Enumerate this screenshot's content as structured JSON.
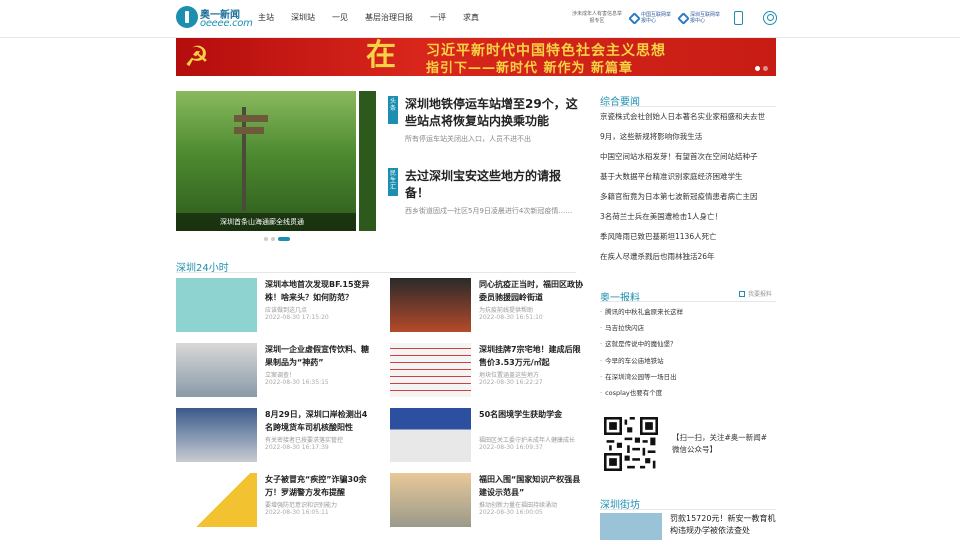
{
  "header": {
    "logo_cn": "奥一新闻",
    "logo_en": "oeeee.com",
    "nav": [
      "主站",
      "深圳站",
      "一见",
      "基层治理日报",
      "一评",
      "求真"
    ],
    "minor_report_note": "涉未成年人有害信息举报专区",
    "report_center_1": "中国互联网举报中心",
    "report_center_2": "深圳互联网举报中心"
  },
  "banner": {
    "big_char": "在",
    "line1": "习近平新时代中国特色社会主义思想",
    "line2": "指引下——新时代 新作为 新篇章"
  },
  "slider": {
    "caption": "深圳首条山海通廊全线贯通"
  },
  "headlines": [
    {
      "tag": "头条",
      "title": "深圳地铁停运车站增至29个，这些站点将恢复站内换乘功能",
      "sub": "所有停运车站关闭出入口，人员不进不出"
    },
    {
      "tag": "民生汇",
      "title": "去过深圳宝安这些地方的请报备！",
      "sub": "西乡街道固戍一社区5月9日凌晨进行4次新冠疫情……"
    }
  ],
  "sz24": {
    "title": "深圳24小时",
    "items": [
      {
        "title": "深圳本地首次发现BF.15变异株！啥来头？如何防范？",
        "sub": "应该做到这几点",
        "time": "2022-08-30 17:15:20"
      },
      {
        "title": "同心抗疫正当时，福田区政协委员驰援园岭街道",
        "sub": "为抗疫前线提供帮助",
        "time": "2022-08-30 16:51:10"
      },
      {
        "title": "深圳一企业虚假宣传饮料、糖果制品为“神药”",
        "sub": "立案调查！",
        "time": "2022-08-30 16:35:15"
      },
      {
        "title": "深圳挂牌7宗宅地！建成后限售价3.53万元/㎡起",
        "sub": "地块位置涵盖这些地方",
        "time": "2022-08-30 16:22:27"
      },
      {
        "title": "8月29日，深圳口岸检测出4名跨境货车司机核酸阳性",
        "sub": "有关密接者已按要求落实管控",
        "time": "2022-08-30 16:17:39"
      },
      {
        "title": "50名困境学生获助学金",
        "sub": "福田区关工委守护未成年人健康成长",
        "time": "2022-08-30 16:09:37"
      },
      {
        "title": "女子被冒充“疾控”诈骗30余万！罗湖警方发布提醒",
        "sub": "要增强防范意识和识别能力",
        "time": "2022-08-30 16:05:11"
      },
      {
        "title": "福田入围“国家知识产权强县建设示范县”",
        "sub": "推动创新力量在福田持续涌动",
        "time": "2022-08-30 16:00:05"
      }
    ]
  },
  "zonghe": {
    "title": "综合要闻",
    "items": [
      "京瓷株式会社创始人日本著名实业家稻盛和夫去世",
      "9月，这些新规将影响你我生活",
      "中国空间站水稻发芽！有望首次在空间站结种子",
      "基于大数据平台精准识别家庭经济困难学生",
      "多籍官衔竟为日本第七波新冠疫情患者病亡主因",
      "3名荷兰士兵在美国遭枪击1人身亡！",
      "季风降雨已致巴基斯坦1136人死亡",
      "在疾人尽遭杀戮后也雨林独活26年"
    ]
  },
  "yibaoliao": {
    "title": "奥一报料",
    "link": "我要报料",
    "items": [
      "腾讯的中秋礼盒原来长这样",
      "马吉拉快闪店",
      "这就是传说中的魔仙堡？",
      "今早的车公庙地铁站",
      "在深圳湾公园等一场日出",
      "cosplay也要有个度"
    ],
    "qr_text": "【扫一扫，关注#奥一新闻#微信公众号】"
  },
  "jiefang": {
    "title": "深圳街坊",
    "item_title": "罚款15720元！新安一教育机构违规办学被依法查处"
  }
}
